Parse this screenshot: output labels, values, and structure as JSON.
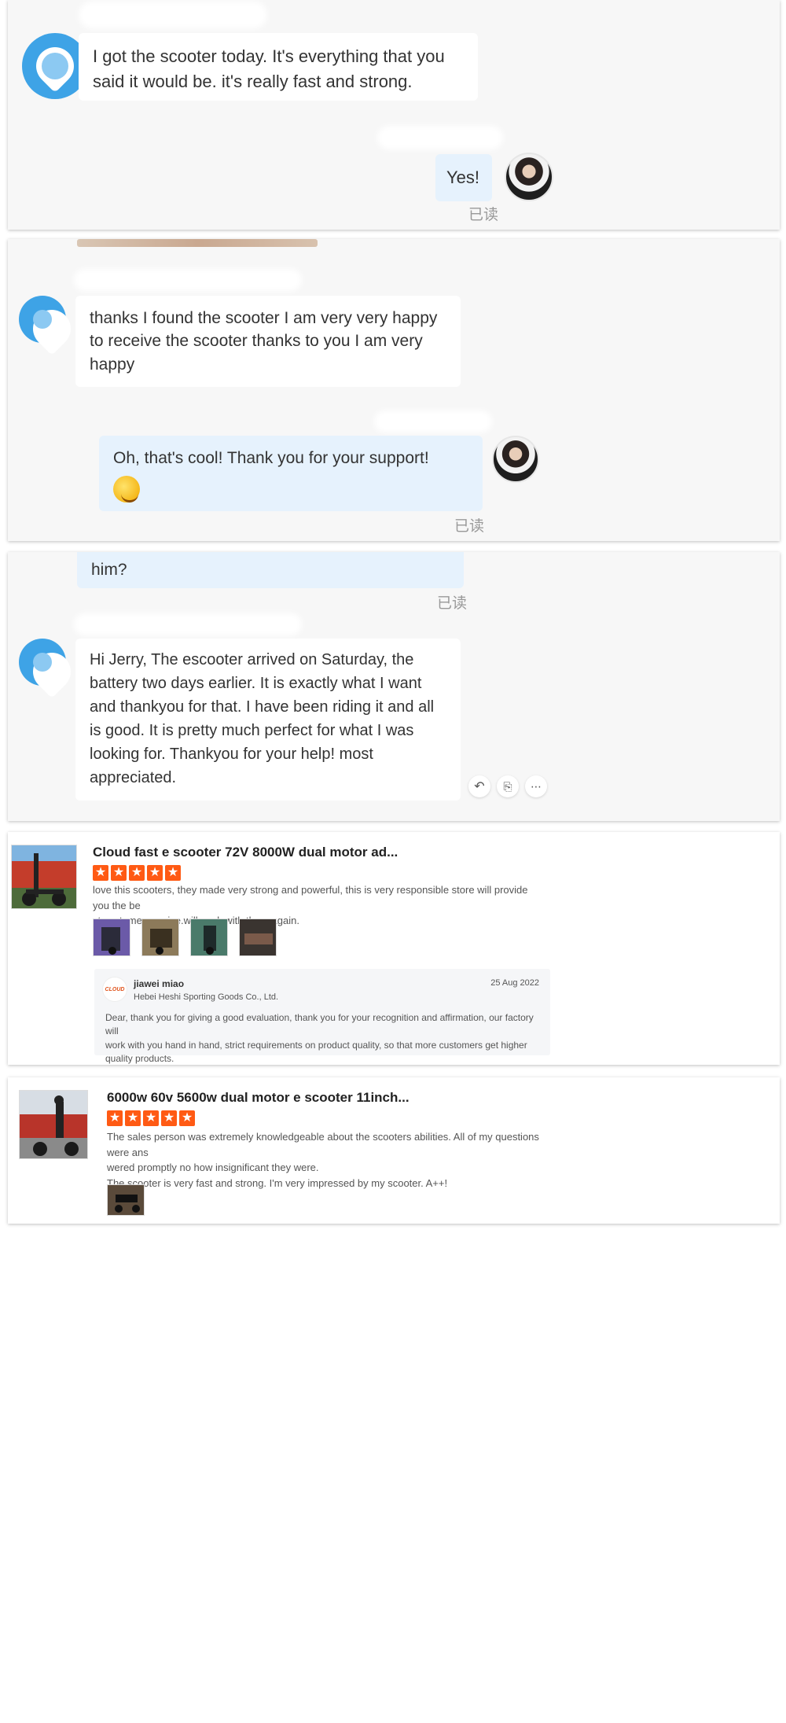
{
  "chat1": {
    "message": "I got the scooter today. It's everything that you said it would be. it's really fast and strong.",
    "reply": "Yes!",
    "read_label": "已读"
  },
  "chat2": {
    "message_lines": [
      "thanks I found the scooter I am very very happy",
      "to receive the scooter thanks to you I am very",
      "happy"
    ],
    "reply": "Oh, that's cool! Thank you for your support!",
    "read_label": "已读"
  },
  "chat3": {
    "prev_fragment": "him?",
    "read_label": "已读",
    "message_lines": [
      "Hi Jerry, The escooter arrived on Saturday, the",
      "battery two days earlier. It is exactly what I want",
      "and thankyou for that. I have been riding it and all",
      "is good. It is pretty much perfect for what I was",
      "looking for. Thankyou for your help! most",
      "appreciated."
    ]
  },
  "review1": {
    "title": "Cloud fast e scooter 72V 8000W dual motor ad...",
    "stars": 5,
    "body_lines": [
      "love this scooters, they made very strong and powerful, this is very responsible store will provide you the be",
      "st customer service.will work with them again."
    ],
    "reply": {
      "name": "jiawei miao",
      "company": "Hebei Heshi Sporting Goods Co., Ltd.",
      "date": "25 Aug 2022",
      "text_lines": [
        "Dear, thank you for giving a good evaluation, thank you for your recognition and affirmation, our factory will",
        "work with you hand in hand, strict requirements on product quality, so that more customers get higher",
        "quality products."
      ]
    }
  },
  "review2": {
    "title": "6000w 60v 5600w dual motor e scooter 11inch...",
    "stars": 5,
    "body_lines": [
      "The sales person was extremely knowledgeable about the scooters abilities.  All of my questions were ans",
      "wered promptly no how insignificant they were.",
      "The scooter is very fast and strong. I'm very impressed by my scooter.  A++!"
    ]
  },
  "star_glyph": "★",
  "icons": [
    "reply-icon",
    "translate-icon",
    "more-icon"
  ]
}
